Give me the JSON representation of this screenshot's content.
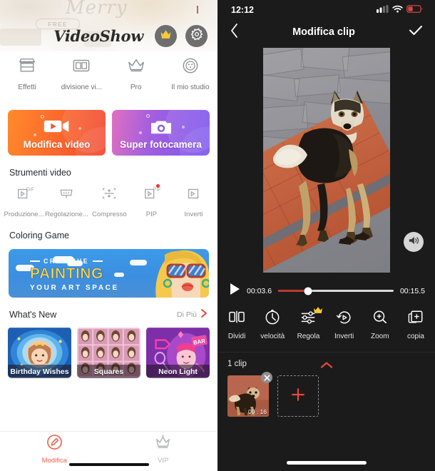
{
  "left": {
    "hero": {
      "script_text": "Merry",
      "free_badge": "FREE"
    },
    "brand": {
      "logo": "VideoShow",
      "crown_icon": "crown-icon",
      "gear_icon": "gear-icon"
    },
    "top_icons": [
      {
        "label": "Effetti",
        "icon": "store-icon"
      },
      {
        "label": "divisione vi...",
        "icon": "split-screen-icon"
      },
      {
        "label": "Pro",
        "icon": "crown-icon"
      },
      {
        "label": "Il mio studio",
        "icon": "studio-icon"
      }
    ],
    "big_buttons": [
      {
        "label": "Modifica video",
        "icon": "video-camera-icon",
        "color": "#f0452f"
      },
      {
        "label": "Super fotocamera",
        "icon": "photo-camera-icon",
        "color": "#7b55f0"
      }
    ],
    "tools_section_title": "Strumenti video",
    "tools": [
      {
        "label": "Produzione...",
        "icon": "gif-icon",
        "badge": false
      },
      {
        "label": "Regolazione...",
        "icon": "trim-icon",
        "badge": false
      },
      {
        "label": "Compresso",
        "icon": "compress-icon",
        "badge": false
      },
      {
        "label": "PIP",
        "icon": "pip-icon",
        "badge": true
      },
      {
        "label": "Inverti",
        "icon": "reverse-icon",
        "badge": false
      }
    ],
    "coloring_section_title": "Coloring Game",
    "banner": {
      "line1": "CREATIVE",
      "line2": "PAINTING",
      "line3": "YOUR ART SPACE"
    },
    "whats_new": {
      "title": "What's New",
      "more_label": "Di Più",
      "more_icon": "chevron-right-icon"
    },
    "cards": [
      {
        "label": "Birthday Wishes"
      },
      {
        "label": "Squares"
      },
      {
        "label": "Neon Light"
      }
    ],
    "tabs": [
      {
        "label": "Modifica",
        "icon": "edit-pencil-icon",
        "active": true
      },
      {
        "label": "VIP",
        "icon": "crown-icon",
        "active": false
      }
    ]
  },
  "right": {
    "status": {
      "time": "12:12",
      "signal_icon": "cellular-signal-icon",
      "wifi_icon": "wifi-icon",
      "battery_icon": "battery-low-icon"
    },
    "nav": {
      "back_icon": "chevron-left-icon",
      "title": "Modifica clip",
      "confirm_icon": "checkmark-icon"
    },
    "preview": {
      "volume_icon": "speaker-icon"
    },
    "player": {
      "play_icon": "play-icon",
      "current_time": "00:03.6",
      "total_time": "00:15.5",
      "progress_percent": 26
    },
    "edit_tools": [
      {
        "label": "Dividi",
        "icon": "split-icon",
        "pro": false
      },
      {
        "label": "velocità",
        "icon": "speed-icon",
        "pro": false
      },
      {
        "label": "Regola",
        "icon": "adjust-sliders-icon",
        "pro": true
      },
      {
        "label": "Inverti",
        "icon": "reverse-icon",
        "pro": false
      },
      {
        "label": "Zoom",
        "icon": "zoom-in-icon",
        "pro": false
      },
      {
        "label": "copia",
        "icon": "copy-icon",
        "pro": false
      }
    ],
    "timeline": {
      "clip_count_label": "1 clip",
      "collapse_icon": "chevron-up-icon",
      "clips": [
        {
          "duration": "00 : 16",
          "remove_icon": "close-icon"
        }
      ],
      "add_icon": "plus-icon"
    }
  },
  "colors": {
    "accent_orange": "#f0604a",
    "accent_red": "#c0392b",
    "dark_bg": "#1b1b1b",
    "gold": "#ffd24a"
  }
}
